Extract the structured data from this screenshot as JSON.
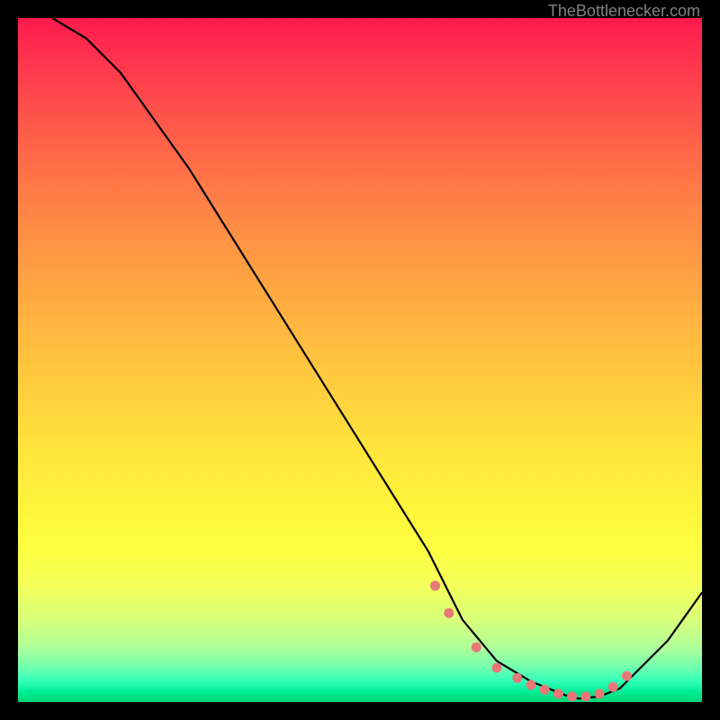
{
  "watermark": "TheBottlenecker.com",
  "chart_data": {
    "type": "line",
    "title": "",
    "xlabel": "",
    "ylabel": "",
    "xlim": [
      0,
      100
    ],
    "ylim": [
      0,
      100
    ],
    "series": [
      {
        "name": "bottleneck-curve",
        "color": "#000000",
        "x": [
          5,
          10,
          15,
          20,
          25,
          30,
          35,
          40,
          45,
          50,
          55,
          60,
          62,
          65,
          70,
          75,
          80,
          82,
          85,
          88,
          90,
          95,
          100
        ],
        "y": [
          100,
          97,
          92,
          85,
          78,
          70,
          62,
          54,
          46,
          38,
          30,
          22,
          18,
          12,
          6,
          3,
          1,
          0.5,
          0.8,
          2,
          4,
          9,
          16
        ]
      },
      {
        "name": "highlight-dots",
        "color": "#e87878",
        "type": "scatter",
        "x": [
          61,
          63,
          67,
          70,
          73,
          75,
          77,
          79,
          81,
          83,
          85,
          87,
          89
        ],
        "y": [
          17,
          13,
          8,
          5,
          3.5,
          2.5,
          1.8,
          1.2,
          0.8,
          0.8,
          1.2,
          2.2,
          3.8
        ]
      }
    ],
    "gradient_stops": [
      {
        "pos": 0,
        "color": "#ff1a4d"
      },
      {
        "pos": 50,
        "color": "#ffc040"
      },
      {
        "pos": 80,
        "color": "#fff840"
      },
      {
        "pos": 100,
        "color": "#00d878"
      }
    ]
  }
}
